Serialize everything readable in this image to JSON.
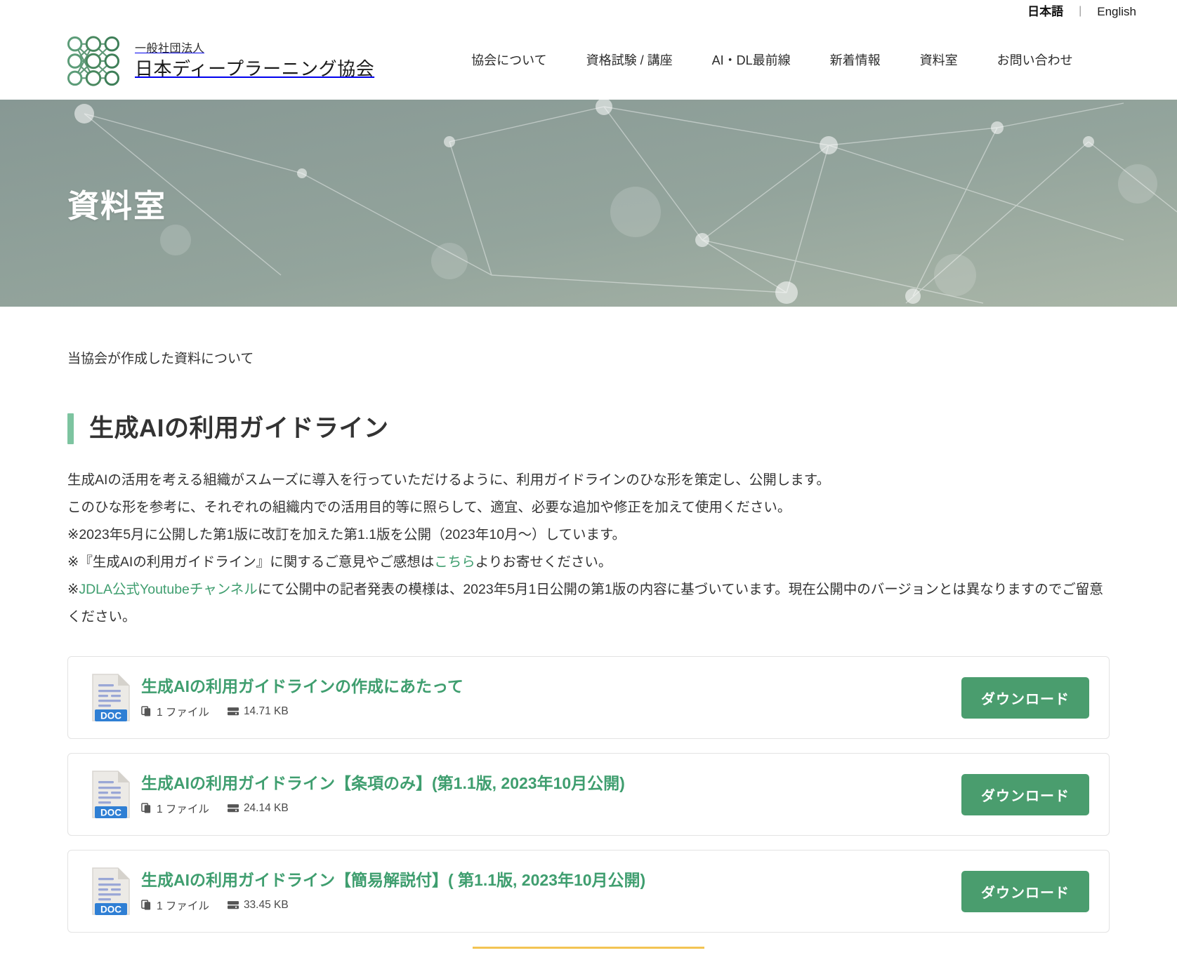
{
  "lang_bar": {
    "japanese": "日本語",
    "separator": "|",
    "english": "English"
  },
  "brand": {
    "sub": "一般社団法人",
    "name": "日本ディープラーニング協会",
    "logo_icon": "neural-network-logo"
  },
  "nav": {
    "items": [
      {
        "label": "協会について"
      },
      {
        "label": "資格試験 / 講座"
      },
      {
        "label": "AI・DL最前線"
      },
      {
        "label": "新着情報"
      },
      {
        "label": "資料室"
      },
      {
        "label": "お問い合わせ"
      }
    ]
  },
  "hero": {
    "title": "資料室",
    "background_color": "#8d9e99",
    "graphic": "network-nodes-pattern"
  },
  "main": {
    "lede": "当協会が作成した資料について",
    "section": {
      "accent_color": "#7dc4a0",
      "title": "生成AIの利用ガイドライン"
    },
    "paragraphs": {
      "p1": "生成AIの活用を考える組織がスムーズに導入を行っていただけるように、利用ガイドラインのひな形を策定し、公開します。",
      "p2": "このひな形を参考に、それぞれの組織内での活用目的等に照らして、適宜、必要な追加や修正を加えて使用ください。",
      "p3": "※2023年5月に公開した第1版に改訂を加えた第1.1版を公開（2023年10月〜）しています。",
      "p4_before": "※『生成AIの利用ガイドライン』に関するご意見やご感想は",
      "p4_link": "こちら",
      "p4_after": "よりお寄せください。",
      "p5_prefix": "※",
      "p5_link": "JDLA公式Youtubeチャンネル",
      "p5_after": "にて公開中の記者発表の模様は、2023年5月1日公開の第1版の内容に基づいています。現在公開中のバージョンとは異なりますのでご留意ください。"
    },
    "link_color": "#3f9e6f"
  },
  "downloads": {
    "button_label": "ダウンロード",
    "button_color": "#4a9d6e",
    "file_icon_label": "DOC",
    "items": [
      {
        "title": "生成AIの利用ガイドラインの作成にあたって",
        "file_count": "1 ファイル",
        "file_size": "14.71 KB",
        "icon": "doc-file-icon"
      },
      {
        "title": "生成AIの利用ガイドライン【条項のみ】(第1.1版, 2023年10月公開)",
        "file_count": "1 ファイル",
        "file_size": "24.14 KB",
        "icon": "doc-file-icon"
      },
      {
        "title": "生成AIの利用ガイドライン【簡易解説付】( 第1.1版, 2023年10月公開)",
        "file_count": "1 ファイル",
        "file_size": "33.45 KB",
        "icon": "doc-file-icon"
      }
    ]
  }
}
